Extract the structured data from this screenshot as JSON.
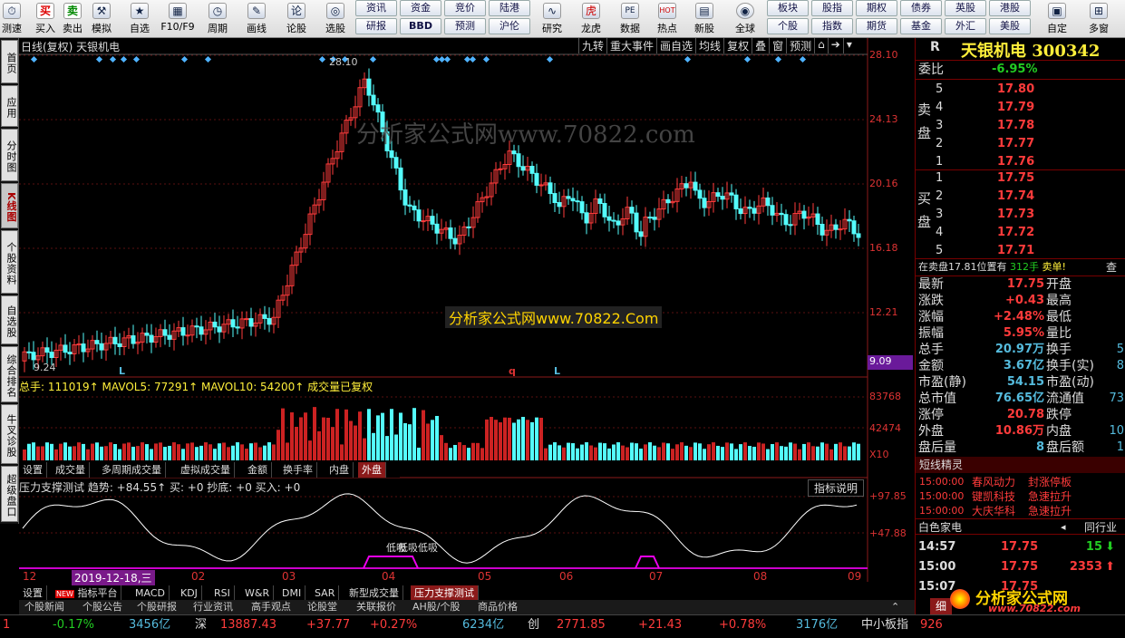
{
  "toolbar": {
    "buttons": [
      {
        "label": "测速",
        "icon": "speed-icon"
      },
      {
        "label": "买入",
        "icon": "buy-icon",
        "glyph": "买"
      },
      {
        "label": "卖出",
        "icon": "sell-icon",
        "glyph": "卖"
      },
      {
        "label": "模拟",
        "icon": "hammer-icon",
        "glyph": "⚒"
      },
      {
        "label": "自选",
        "icon": "star-icon",
        "glyph": "★"
      },
      {
        "label": "F10/F9",
        "icon": "grid-icon",
        "glyph": "▦"
      },
      {
        "label": "周期",
        "icon": "clock-icon",
        "glyph": "◷"
      },
      {
        "label": "画线",
        "icon": "pencil-icon",
        "glyph": "✎"
      },
      {
        "label": "论股",
        "icon": "forum-icon",
        "glyph": "论"
      },
      {
        "label": "选股",
        "icon": "search-stock-icon",
        "glyph": "◎"
      }
    ],
    "grid_buttons": [
      "资讯",
      "资金",
      "竞价",
      "陆港",
      "研报",
      "BBD",
      "预测",
      "沪伦"
    ],
    "right_buttons": [
      {
        "label": "研究",
        "glyph": "∿"
      },
      {
        "label": "龙虎",
        "glyph": "虎"
      },
      {
        "label": "数据",
        "glyph": "PE"
      },
      {
        "label": "热点",
        "glyph": "HOT"
      },
      {
        "label": "新股",
        "glyph": "▤"
      },
      {
        "label": "全球",
        "glyph": "◉"
      }
    ],
    "grid2": [
      "板块",
      "股指",
      "期权",
      "债券",
      "英股",
      "个股",
      "指数",
      "期货",
      "基金",
      "外汇",
      "港股",
      "美股"
    ],
    "end": [
      {
        "label": "自定",
        "glyph": "▣"
      },
      {
        "label": "多窗",
        "glyph": "⊞"
      }
    ]
  },
  "leftnav": [
    "首页",
    "应用",
    "分时图",
    "K线图",
    "个股资料",
    "自选股",
    "综合排名",
    "牛叉诊股",
    "超级盘口"
  ],
  "chart": {
    "header": "日线(复权) 天银机电",
    "top_tabs": [
      "九转",
      "重大事件",
      "画自选",
      "均线",
      "复权",
      "叠",
      "窗",
      "预测"
    ],
    "peak_label": "28.10",
    "low_label": "9.24",
    "price_axis": [
      "28.10",
      "24.13",
      "20.16",
      "16.18",
      "12.21",
      "9.09"
    ],
    "watermark1": "分析家公式网www.70822.com",
    "watermark2": "分析家公式网www.70822.Com",
    "markers": [
      "L",
      "q",
      "L"
    ]
  },
  "volume": {
    "title": "总手: 111019↑ MAVOL5: 77291↑ MAVOL10: 54200↑ 成交量已复权",
    "axis": [
      "83768",
      "42474",
      "X10"
    ],
    "tabs": [
      "设置",
      "成交量",
      "多周期成交量",
      "虚拟成交量",
      "金额",
      "换手率",
      "内盘",
      "外盘"
    ]
  },
  "indicator": {
    "title": "压力支撑测试 趋势: +84.55↑ 买: +0 抄底: +0 买入: +0",
    "explain_btn": "指标说明",
    "axis": [
      "+97.85",
      "+47.88"
    ],
    "low_labels": [
      "低吸",
      "低吸",
      "低吸"
    ],
    "x_axis": [
      "12",
      "2019-12-18,三",
      "02",
      "03",
      "04",
      "05",
      "06",
      "07",
      "08",
      "09"
    ],
    "tabs": [
      "设置",
      "指标平台",
      "MACD",
      "KDJ",
      "RSI",
      "W&R",
      "DMI",
      "SAR",
      "新型成交量",
      "压力支撑测试"
    ],
    "new_badge": "NEW"
  },
  "newsbar": [
    "个股新闻",
    "个股公告",
    "个股研报",
    "行业资讯",
    "高手观点",
    "论股堂",
    "关联报价",
    "AH股/个股",
    "商品价格"
  ],
  "quote": {
    "market": "R",
    "name": "天银机电 300342",
    "weibi_label": "委比",
    "weibi": "-6.95%",
    "sell_label": "卖盘",
    "buy_label": "买盘",
    "sell": [
      [
        "5",
        "17.80"
      ],
      [
        "4",
        "17.79"
      ],
      [
        "3",
        "17.78"
      ],
      [
        "2",
        "17.77"
      ],
      [
        "1",
        "17.76"
      ]
    ],
    "buy": [
      [
        "1",
        "17.75"
      ],
      [
        "2",
        "17.74"
      ],
      [
        "3",
        "17.73"
      ],
      [
        "4",
        "17.72"
      ],
      [
        "5",
        "17.71"
      ]
    ],
    "notice": "在卖盘17.81位置有",
    "notice_qty": "312手",
    "notice_act": "卖单!",
    "notice_btn": "查",
    "stats": [
      [
        "最新",
        "17.75",
        "开盘",
        ""
      ],
      [
        "涨跌",
        "+0.43",
        "最高",
        ""
      ],
      [
        "涨幅",
        "+2.48%",
        "最低",
        ""
      ],
      [
        "振幅",
        "5.95%",
        "量比",
        ""
      ],
      [
        "总手",
        "20.97万",
        "换手",
        "5"
      ],
      [
        "金额",
        "3.67亿",
        "换手(实)",
        "8"
      ],
      [
        "市盈(静)",
        "54.15",
        "市盈(动)",
        ""
      ],
      [
        "总市值",
        "76.65亿",
        "流通值",
        "73"
      ],
      [
        "涨停",
        "20.78",
        "跌停",
        ""
      ],
      [
        "外盘",
        "10.86万",
        "内盘",
        "10"
      ],
      [
        "盘后量",
        "8",
        "盘后额",
        "1"
      ]
    ],
    "jingling_title": "短线精灵",
    "jingling": [
      [
        "15:00:00",
        "春风动力",
        "封涨停板"
      ],
      [
        "15:00:00",
        "键凯科技",
        "急速拉升"
      ],
      [
        "15:00:00",
        "大庆华科",
        "急速拉升"
      ]
    ],
    "sector": "白色家电",
    "sector_btn": "同行业",
    "ticks": [
      [
        "14:57",
        "17.75",
        "15",
        "down"
      ],
      [
        "15:00",
        "17.75",
        "2353",
        "up"
      ],
      [
        "15:07",
        "17.75",
        "",
        ""
      ]
    ],
    "detail_btn": "细"
  },
  "statusbar": {
    "sh": "1",
    "sh_pct": "-0.17%",
    "sh_amt": "3456亿",
    "sz_label": "深",
    "sz": "13887.43",
    "sz_chg": "+37.77",
    "sz_pct": "+0.27%",
    "sz_amt": "6234亿",
    "cy_label": "创",
    "cy": "2771.85",
    "cy_chg": "+21.43",
    "cy_pct": "+0.78%",
    "cy_amt": "3176亿",
    "zx": "中小板指",
    "zx_val": "926"
  },
  "logo": {
    "text": "分析家公式网",
    "url": "www.70822.com"
  }
}
